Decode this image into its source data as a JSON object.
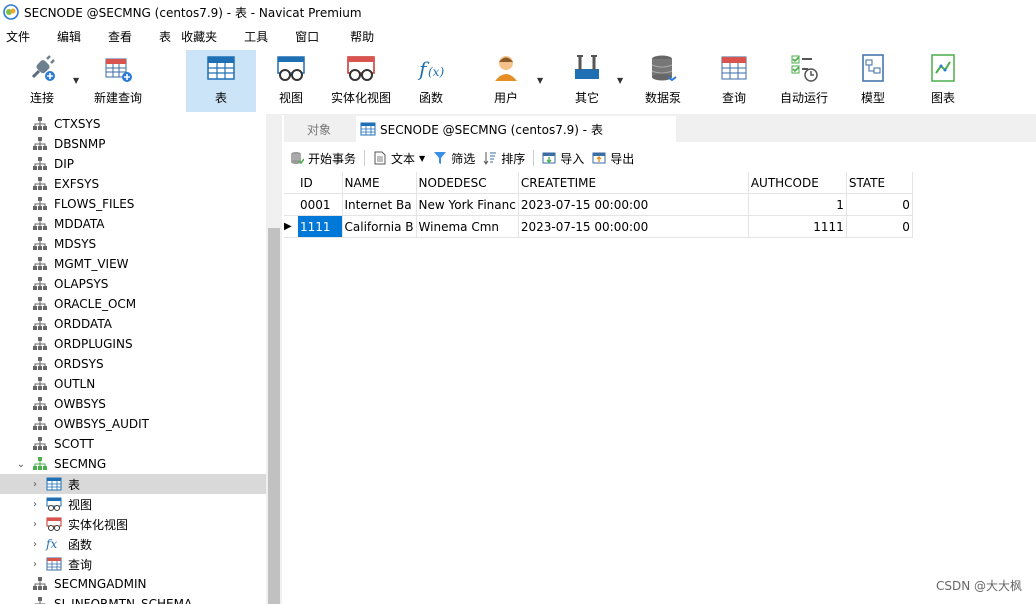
{
  "window": {
    "title": "SECNODE @SECMNG (centos7.9) - 表 - Navicat Premium"
  },
  "menu": [
    "文件",
    "编辑",
    "查看",
    "表",
    "收藏夹",
    "工具",
    "窗口",
    "帮助"
  ],
  "toolbar": {
    "connect": "连接",
    "new_query": "新建查询",
    "table": "表",
    "view": "视图",
    "mview": "实体化视图",
    "function": "函数",
    "user": "用户",
    "other": "其它",
    "pump": "数据泵",
    "query": "查询",
    "auto_run": "自动运行",
    "model": "模型",
    "chart": "图表"
  },
  "sidebar": {
    "schemas": [
      "CTXSYS",
      "DBSNMP",
      "DIP",
      "EXFSYS",
      "FLOWS_FILES",
      "MDDATA",
      "MDSYS",
      "MGMT_VIEW",
      "OLAPSYS",
      "ORACLE_OCM",
      "ORDDATA",
      "ORDPLUGINS",
      "ORDSYS",
      "OUTLN",
      "OWBSYS",
      "OWBSYS_AUDIT",
      "SCOTT"
    ],
    "current_schema": "SECMNG",
    "children": [
      "表",
      "视图",
      "实体化视图",
      "函数",
      "查询"
    ],
    "after": [
      "SECMNGADMIN",
      "SI_INFORMTN_SCHEMA"
    ]
  },
  "tabs": {
    "objects": "对象",
    "active": "SECNODE @SECMNG (centos7.9) - 表"
  },
  "subtoolbar": {
    "begin_tx": "开始事务",
    "text": "文本",
    "filter": "筛选",
    "sort": "排序",
    "import": "导入",
    "export": "导出"
  },
  "grid": {
    "columns": [
      "ID",
      "NAME",
      "NODEDESC",
      "CREATETIME",
      "AUTHCODE",
      "STATE"
    ],
    "rows": [
      [
        "0001",
        "Internet Ba",
        "New York Financ",
        "2023-07-15 00:00:00",
        "1",
        "0"
      ],
      [
        "1111",
        "California B",
        "Winema Cmn",
        "2023-07-15 00:00:00",
        "1111",
        "0"
      ]
    ]
  },
  "watermark": "CSDN @大大枫",
  "colors": {
    "accent": "#0078d7",
    "active_tool_bg": "#cce4f7",
    "selected_row_bg": "#d9d9d9"
  }
}
